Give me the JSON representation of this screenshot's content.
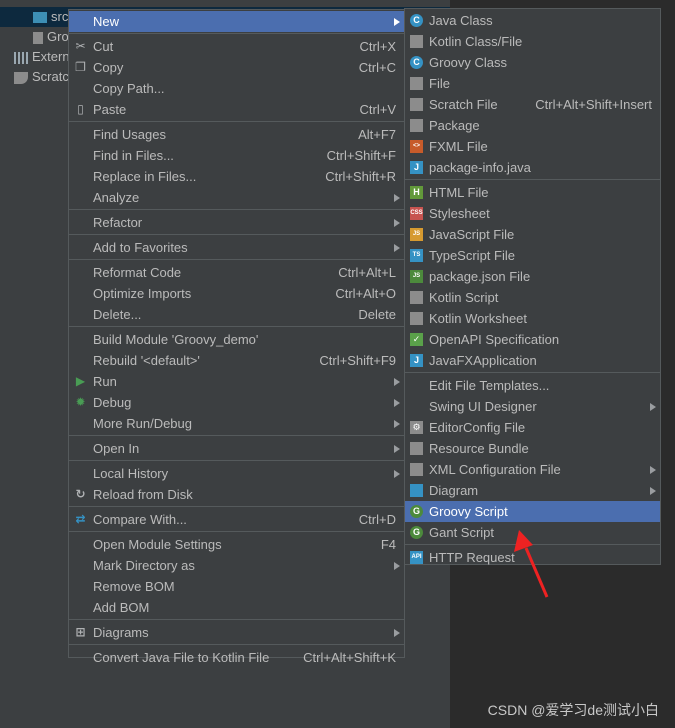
{
  "tree": {
    "items": [
      "src",
      "Gro",
      "Extern",
      "Scratc"
    ]
  },
  "main_menu": [
    {
      "label": "New",
      "submenu": true,
      "highlight": true
    },
    "sep",
    {
      "label": "Cut",
      "shortcut": "Ctrl+X",
      "icon": "scissors-icon"
    },
    {
      "label": "Copy",
      "shortcut": "Ctrl+C",
      "icon": "copy-icon"
    },
    {
      "label": "Copy Path...",
      "shortcut": ""
    },
    {
      "label": "Paste",
      "shortcut": "Ctrl+V",
      "icon": "clipboard-icon"
    },
    "sep",
    {
      "label": "Find Usages",
      "shortcut": "Alt+F7"
    },
    {
      "label": "Find in Files...",
      "shortcut": "Ctrl+Shift+F"
    },
    {
      "label": "Replace in Files...",
      "shortcut": "Ctrl+Shift+R"
    },
    {
      "label": "Analyze",
      "submenu": true
    },
    "sep",
    {
      "label": "Refactor",
      "submenu": true
    },
    "sep",
    {
      "label": "Add to Favorites",
      "submenu": true
    },
    "sep",
    {
      "label": "Reformat Code",
      "shortcut": "Ctrl+Alt+L"
    },
    {
      "label": "Optimize Imports",
      "shortcut": "Ctrl+Alt+O"
    },
    {
      "label": "Delete...",
      "shortcut": "Delete"
    },
    "sep",
    {
      "label": "Build Module 'Groovy_demo'",
      "shortcut": ""
    },
    {
      "label": "Rebuild '<default>'",
      "shortcut": "Ctrl+Shift+F9"
    },
    {
      "label": "Run",
      "submenu": true,
      "icon": "run-icon"
    },
    {
      "label": "Debug",
      "submenu": true,
      "icon": "debug-icon"
    },
    {
      "label": "More Run/Debug",
      "submenu": true
    },
    "sep",
    {
      "label": "Open In",
      "submenu": true
    },
    "sep",
    {
      "label": "Local History",
      "submenu": true
    },
    {
      "label": "Reload from Disk",
      "icon": "reload-icon"
    },
    "sep",
    {
      "label": "Compare With...",
      "shortcut": "Ctrl+D",
      "icon": "compare-icon"
    },
    "sep",
    {
      "label": "Open Module Settings",
      "shortcut": "F4"
    },
    {
      "label": "Mark Directory as",
      "submenu": true
    },
    {
      "label": "Remove BOM"
    },
    {
      "label": "Add BOM"
    },
    "sep",
    {
      "label": "Diagrams",
      "submenu": true,
      "icon": "diagram-icon"
    },
    "sep",
    {
      "label": "Convert Java File to Kotlin File",
      "shortcut": "Ctrl+Alt+Shift+K"
    }
  ],
  "sub_menu": [
    {
      "label": "Java Class",
      "icon": "java-class-icon",
      "color": "#3592c4",
      "glyph": "C"
    },
    {
      "label": "Kotlin Class/File",
      "icon": "kotlin-file-icon",
      "color": "#8c8c8c",
      "glyph": ""
    },
    {
      "label": "Groovy Class",
      "icon": "groovy-class-icon",
      "color": "#3592c4",
      "glyph": "C"
    },
    {
      "label": "File",
      "icon": "file-icon",
      "color": "#8c8c8c",
      "glyph": ""
    },
    {
      "label": "Scratch File",
      "shortcut": "Ctrl+Alt+Shift+Insert",
      "icon": "scratch-file-icon",
      "color": "#8c8c8c",
      "glyph": ""
    },
    {
      "label": "Package",
      "icon": "package-icon",
      "color": "#8c8c8c",
      "glyph": ""
    },
    {
      "label": "FXML File",
      "icon": "fxml-icon",
      "color": "#c75b2a",
      "glyph": "<>"
    },
    {
      "label": "package-info.java",
      "icon": "java-file-icon",
      "color": "#3592c4",
      "glyph": "J"
    },
    "sep",
    {
      "label": "HTML File",
      "icon": "html-icon",
      "color": "#62993a",
      "glyph": "H"
    },
    {
      "label": "Stylesheet",
      "icon": "css-icon",
      "color": "#c75450",
      "glyph": "CSS"
    },
    {
      "label": "JavaScript File",
      "icon": "js-icon",
      "color": "#d69a30",
      "glyph": "JS"
    },
    {
      "label": "TypeScript File",
      "icon": "ts-icon",
      "color": "#3592c4",
      "glyph": "TS"
    },
    {
      "label": "package.json File",
      "icon": "nodejs-icon",
      "color": "#4c8a3c",
      "glyph": "JS"
    },
    {
      "label": "Kotlin Script",
      "icon": "kotlin-script-icon",
      "color": "#8c8c8c",
      "glyph": ""
    },
    {
      "label": "Kotlin Worksheet",
      "icon": "kotlin-worksheet-icon",
      "color": "#8c8c8c",
      "glyph": ""
    },
    {
      "label": "OpenAPI Specification",
      "icon": "openapi-icon",
      "color": "#5aa14a",
      "glyph": "✓"
    },
    {
      "label": "JavaFXApplication",
      "icon": "javafx-icon",
      "color": "#3592c4",
      "glyph": "J"
    },
    "sep",
    {
      "label": "Edit File Templates..."
    },
    {
      "label": "Swing UI Designer",
      "submenu": true
    },
    {
      "label": "EditorConfig File",
      "icon": "gear-icon",
      "color": "#8c8c8c",
      "glyph": "⚙"
    },
    {
      "label": "Resource Bundle",
      "icon": "resource-bundle-icon",
      "color": "#8c8c8c",
      "glyph": ""
    },
    {
      "label": "XML Configuration File",
      "submenu": true,
      "icon": "xml-icon",
      "color": "#8c8c8c",
      "glyph": ""
    },
    {
      "label": "Diagram",
      "submenu": true,
      "icon": "diagram-icon",
      "color": "#3592c4",
      "glyph": ""
    },
    {
      "label": "Groovy Script",
      "highlight": true,
      "icon": "groovy-script-icon",
      "color": "#4c8a3c",
      "glyph": "G"
    },
    {
      "label": "Gant Script",
      "icon": "gant-script-icon",
      "color": "#4c8a3c",
      "glyph": "G"
    },
    "sep",
    {
      "label": "HTTP Request",
      "icon": "http-request-icon",
      "color": "#3592c4",
      "glyph": "API"
    }
  ],
  "watermark": "CSDN @爱学习de测试小白"
}
